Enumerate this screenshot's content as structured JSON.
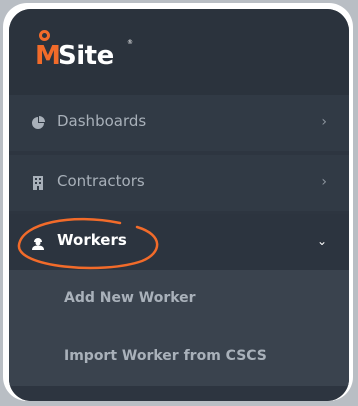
{
  "brand": {
    "name_m": "M",
    "name_rest": "Site",
    "reg": "®",
    "accent": "#f26b2a"
  },
  "menu": [
    {
      "label": "Dashboards",
      "icon": "pie-chart-icon",
      "expanded": false
    },
    {
      "label": "Contractors",
      "icon": "building-icon",
      "expanded": false
    },
    {
      "label": "Workers",
      "icon": "worker-icon",
      "expanded": true
    }
  ],
  "submenu": [
    {
      "label": "Add New Worker"
    },
    {
      "label": "Import Worker from CSCS"
    }
  ],
  "colors": {
    "sidebar_bg": "#2d3540",
    "submenu_bg": "#3a434e",
    "annotation": "#f26b2a"
  }
}
